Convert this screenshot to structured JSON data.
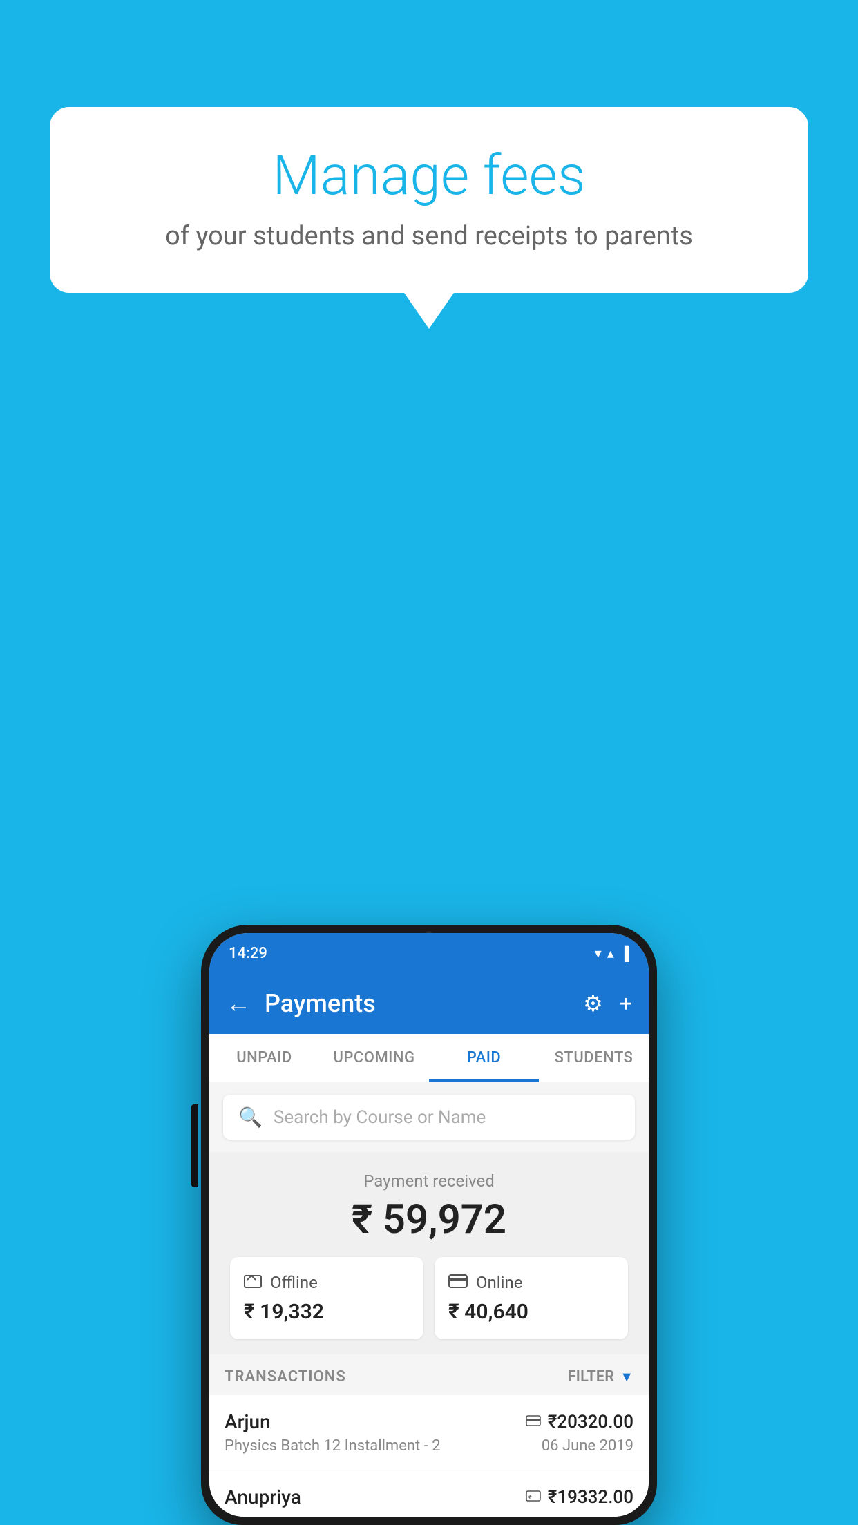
{
  "background_color": "#1ab5e8",
  "speech_bubble": {
    "title": "Manage fees",
    "subtitle": "of your students and send receipts to parents"
  },
  "phone": {
    "status_bar": {
      "time": "14:29",
      "wifi": "▼",
      "signal": "▲",
      "battery": "▌"
    },
    "app_bar": {
      "title": "Payments",
      "back_label": "←",
      "gear_label": "⚙",
      "plus_label": "+"
    },
    "tabs": [
      {
        "label": "UNPAID",
        "active": false
      },
      {
        "label": "UPCOMING",
        "active": false
      },
      {
        "label": "PAID",
        "active": true
      },
      {
        "label": "STUDENTS",
        "active": false
      }
    ],
    "search": {
      "placeholder": "Search by Course or Name"
    },
    "payment_summary": {
      "label": "Payment received",
      "amount": "₹ 59,972",
      "offline": {
        "type": "Offline",
        "amount": "₹ 19,332",
        "icon": "💳"
      },
      "online": {
        "type": "Online",
        "amount": "₹ 40,640",
        "icon": "💳"
      }
    },
    "transactions": {
      "label": "TRANSACTIONS",
      "filter_label": "FILTER",
      "rows": [
        {
          "name": "Arjun",
          "course": "Physics Batch 12 Installment - 2",
          "amount": "₹20320.00",
          "date": "06 June 2019",
          "icon": "💳"
        },
        {
          "name": "Anupriya",
          "course": "",
          "amount": "₹19332.00",
          "date": "",
          "icon": "💴"
        }
      ]
    }
  }
}
